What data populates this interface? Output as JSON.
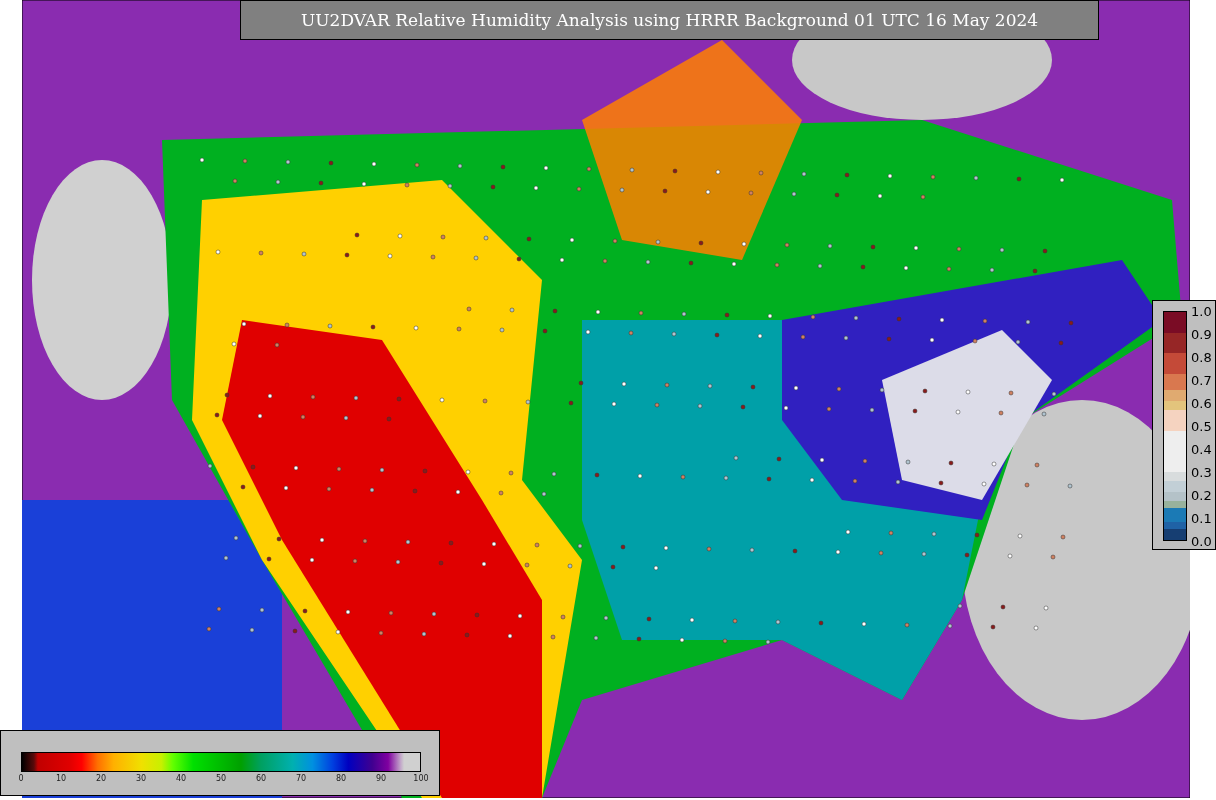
{
  "title": "UU2DVAR Relative Humidity Analysis using HRRR Background 01 UTC 16 May 2024",
  "humidity_colorbar": {
    "ticks": [
      "0",
      "10",
      "20",
      "30",
      "40",
      "50",
      "60",
      "70",
      "80",
      "90",
      "100"
    ]
  },
  "observation_colorbar": {
    "ticks": [
      "1.0",
      "0.9",
      "0.8",
      "0.7",
      "0.6",
      "0.5",
      "0.4",
      "0.3",
      "0.2",
      "0.1",
      "0.0"
    ]
  }
}
